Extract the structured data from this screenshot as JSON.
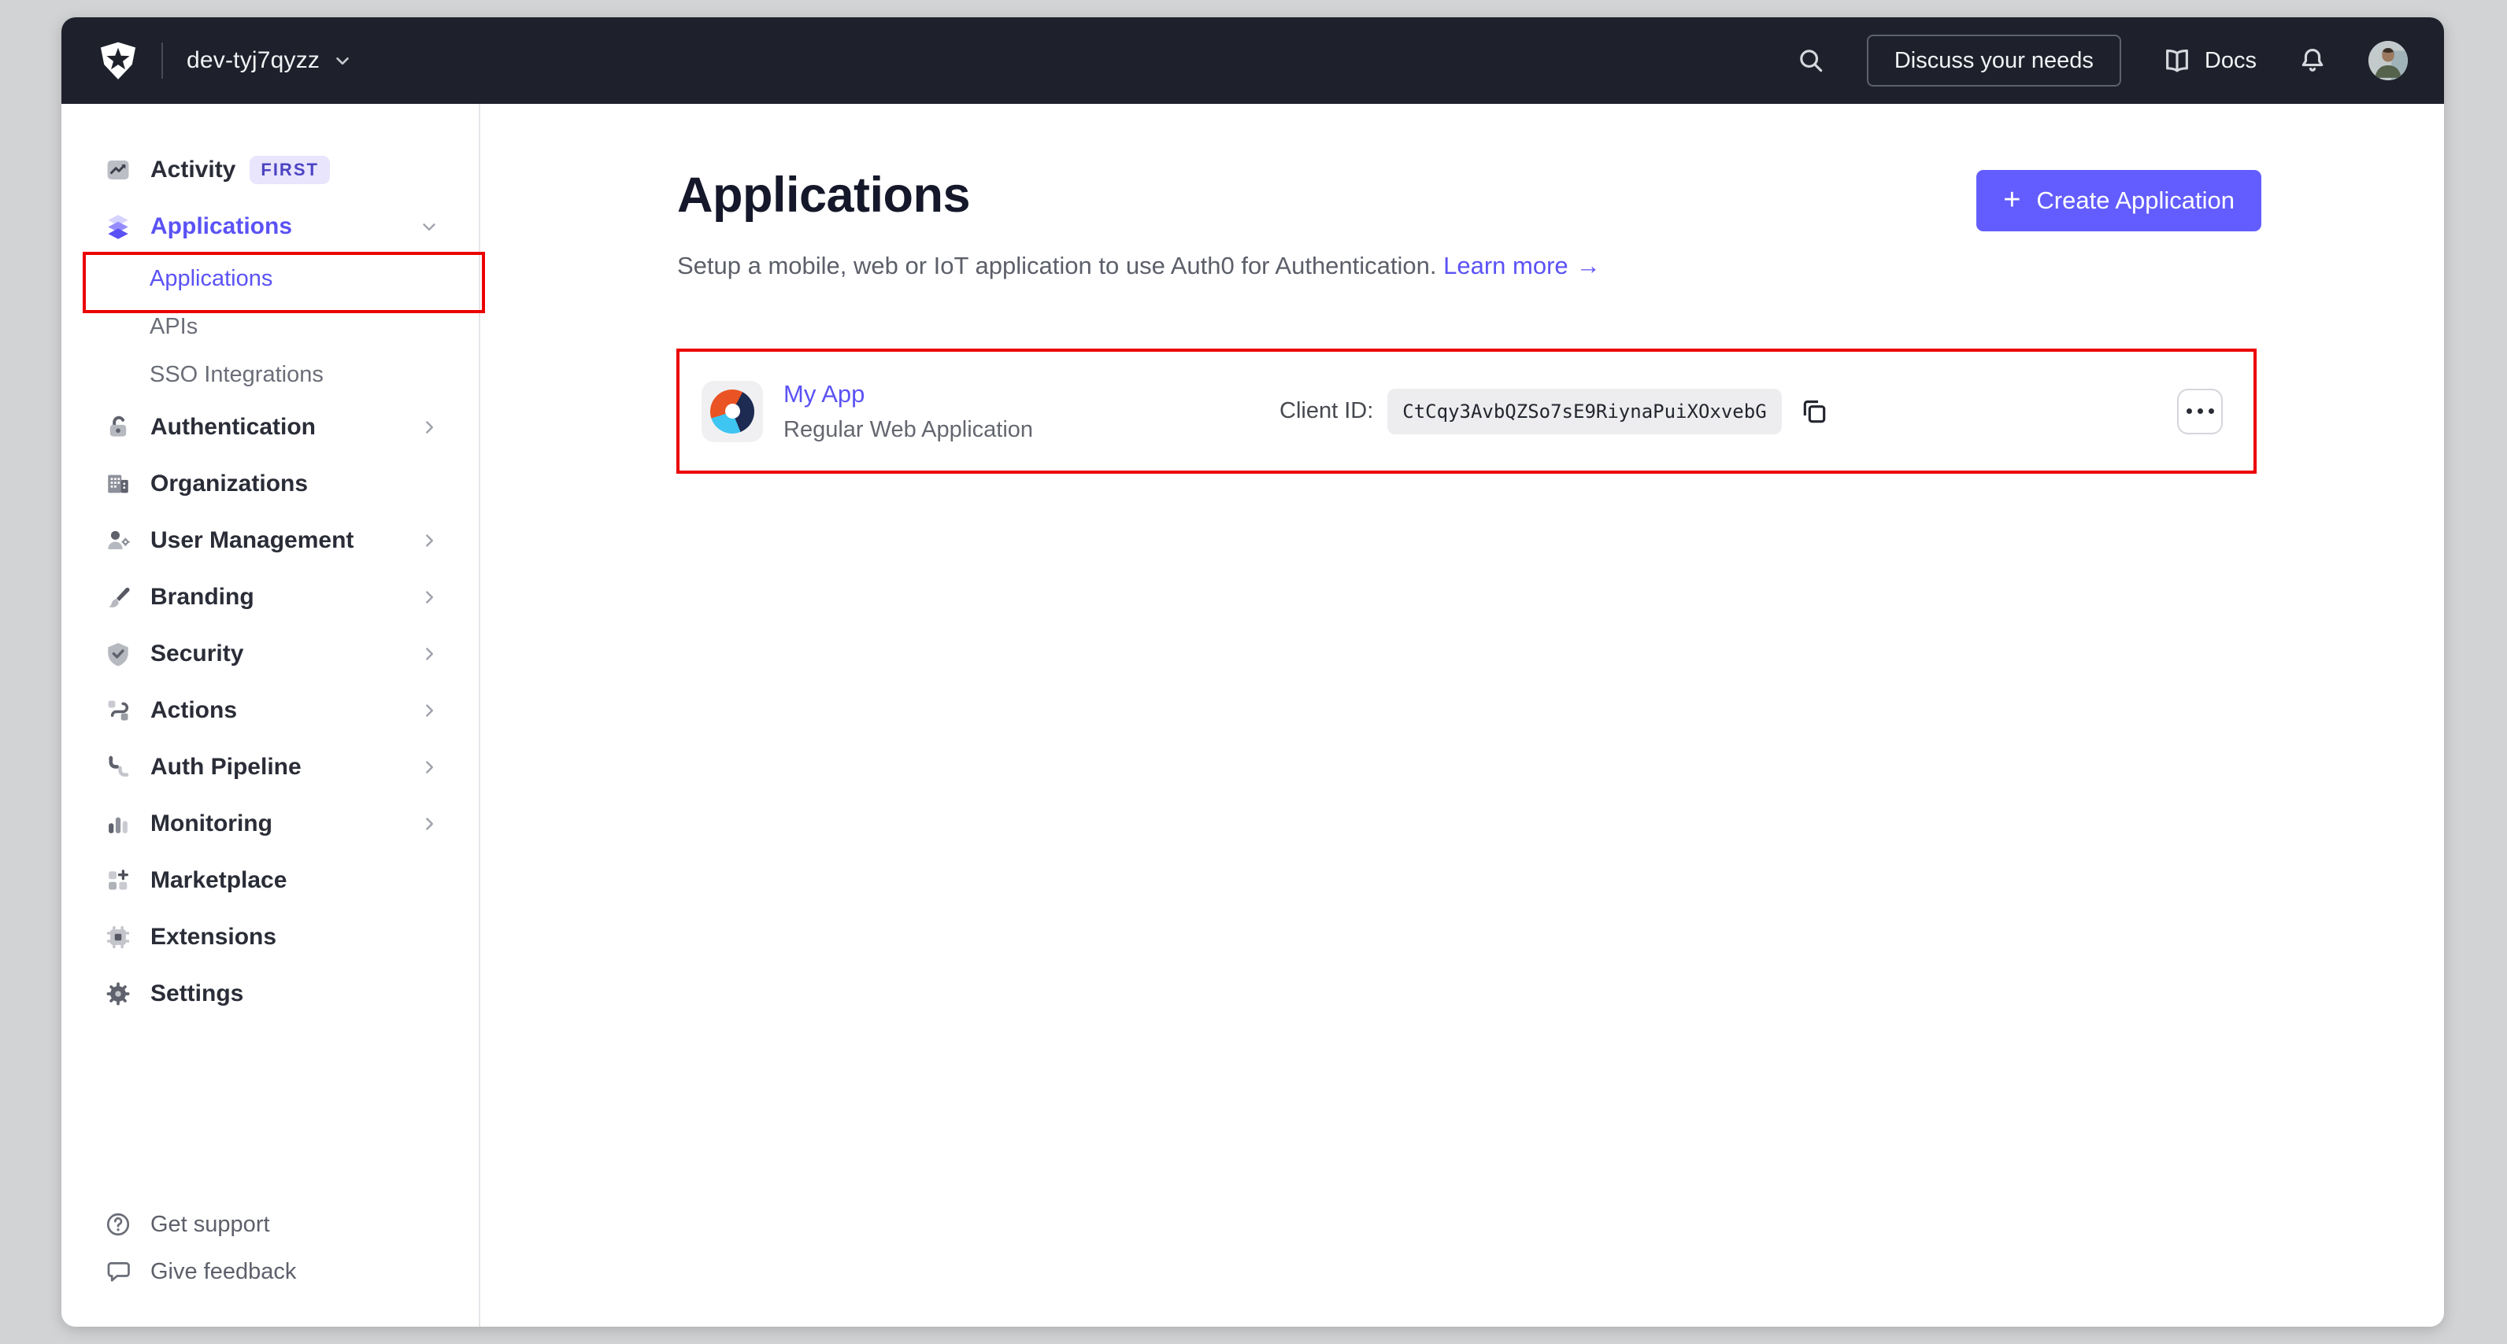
{
  "colors": {
    "canvas": "#D2D3D5",
    "navbar_bg": "#1E212B",
    "accent_button": "#635DFF",
    "accent_link": "#5B52F5",
    "annotation_red": "#EC0000",
    "badge_bg": "#E8E5FD",
    "badge_text": "#4C44C2",
    "chip_bg": "#EDEDEF",
    "logo_orange": "#EA5323",
    "logo_navy": "#1D2A52",
    "logo_blue": "#3EC5F1"
  },
  "navbar": {
    "tenant": "dev-tyj7qyzz",
    "discuss_label": "Discuss your needs",
    "docs_label": "Docs",
    "icons": [
      "auth0-logo",
      "chevron-down-icon",
      "search-icon",
      "book-icon",
      "bell-icon",
      "avatar"
    ]
  },
  "sidebar": {
    "items": [
      {
        "label": "Activity",
        "badge": "FIRST",
        "icon": "activity-icon",
        "chevron": null
      },
      {
        "label": "Applications",
        "icon": "applications-icon",
        "chevron": "down",
        "selected": true
      },
      {
        "label": "Applications",
        "sub": true,
        "selected": true
      },
      {
        "label": "APIs",
        "sub": true
      },
      {
        "label": "SSO Integrations",
        "sub": true
      },
      {
        "label": "Authentication",
        "icon": "lock-icon",
        "chevron": "right"
      },
      {
        "label": "Organizations",
        "icon": "building-icon",
        "chevron": null
      },
      {
        "label": "User Management",
        "icon": "user-gear-icon",
        "chevron": "right"
      },
      {
        "label": "Branding",
        "icon": "paintbrush-icon",
        "chevron": "right"
      },
      {
        "label": "Security",
        "icon": "shield-check-icon",
        "chevron": "right"
      },
      {
        "label": "Actions",
        "icon": "flow-icon",
        "chevron": "right"
      },
      {
        "label": "Auth Pipeline",
        "icon": "pipeline-icon",
        "chevron": "right"
      },
      {
        "label": "Monitoring",
        "icon": "bar-chart-icon",
        "chevron": "right"
      },
      {
        "label": "Marketplace",
        "icon": "grid-plus-icon",
        "chevron": null
      },
      {
        "label": "Extensions",
        "icon": "chip-icon",
        "chevron": null
      },
      {
        "label": "Settings",
        "icon": "gear-icon",
        "chevron": null
      }
    ],
    "footer": [
      {
        "label": "Get support",
        "icon": "help-circle-icon"
      },
      {
        "label": "Give feedback",
        "icon": "chat-bubble-icon"
      }
    ]
  },
  "main": {
    "title": "Applications",
    "subtitle": "Setup a mobile, web or IoT application to use Auth0 for Authentication.",
    "learn_more": "Learn more",
    "arrow": "→",
    "plus": "+",
    "create_button": "Create Application"
  },
  "application": {
    "name": "My App",
    "type": "Regular Web Application",
    "client_id_label": "Client ID:",
    "client_id": "CtCqy3AvbQZSo7sE9RiynaPuiXOxvebG",
    "icons": [
      "app-logo",
      "copy-icon",
      "more-options-button"
    ]
  }
}
